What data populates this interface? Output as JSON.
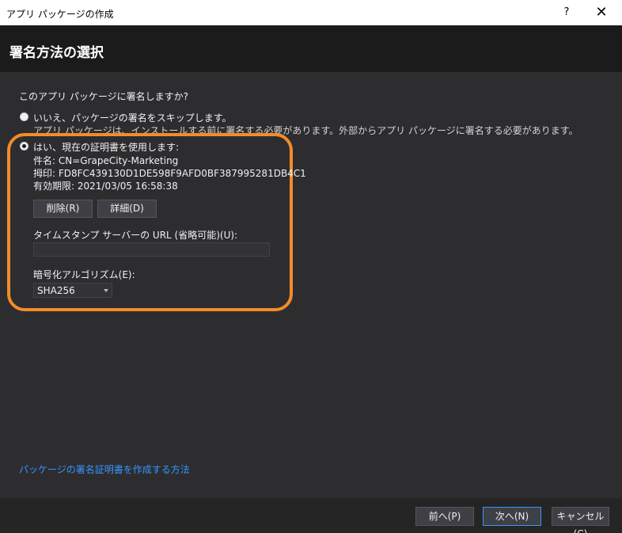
{
  "window": {
    "title": "アプリ パッケージの作成",
    "help_label": "?",
    "close_label": "✕"
  },
  "header": {
    "title": "署名方法の選択"
  },
  "main": {
    "question": "このアプリ パッケージに署名しますか?",
    "option_skip": {
      "label": "いいえ、パッケージの署名をスキップします。",
      "description": "アプリ パッケージは、インストールする前に署名する必要があります。外部からアプリ パッケージに署名する必要があります。"
    },
    "option_use_current": {
      "label": "はい、現在の証明書を使用します:",
      "subject": "件名: CN=GrapeCity-Marketing",
      "thumbprint": "拇印: FD8FC439130D1DE598F9AFD0BF387995281DB4C1",
      "expiry": "有効期限: 2021/03/05 16:58:38"
    },
    "remove_button": "削除(R)",
    "details_button": "詳細(D)",
    "timestamp_label": "タイムスタンプ サーバーの URL (省略可能)(U):",
    "timestamp_value": "",
    "algorithm_label": "暗号化アルゴリズム(E):",
    "algorithm_value": "SHA256",
    "help_link": "パッケージの署名証明書を作成する方法"
  },
  "footer": {
    "back_button": "前へ(P)",
    "next_button": "次へ(N)",
    "cancel_button": "キャンセル(C)"
  },
  "colors": {
    "accent": "#3794ff",
    "highlight": "#f28c28",
    "background": "#2d2d30",
    "header_background": "#1b1b1c"
  }
}
